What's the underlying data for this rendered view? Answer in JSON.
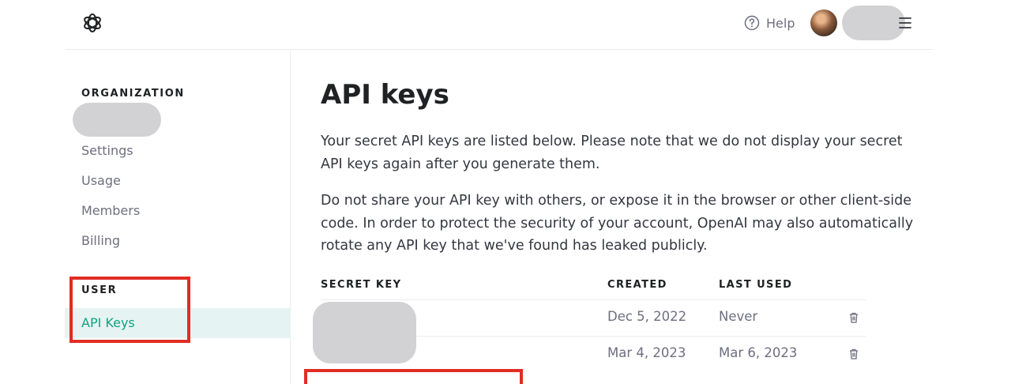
{
  "header": {
    "logo_icon": "openai-logo-icon",
    "help_icon": "question-circle-icon",
    "help_label": "Help",
    "avatar_icon": "user-avatar",
    "menu_icon": "hamburger-menu-icon"
  },
  "sidebar": {
    "organization_title": "ORGANIZATION",
    "org_items": [
      {
        "label": "Settings"
      },
      {
        "label": "Usage"
      },
      {
        "label": "Members"
      },
      {
        "label": "Billing"
      }
    ],
    "user_title": "USER",
    "user_items": [
      {
        "label": "API Keys",
        "active": true
      }
    ]
  },
  "main": {
    "title": "API keys",
    "paragraph_1": "Your secret API keys are listed below. Please note that we do not display your secret API keys again after you generate them.",
    "paragraph_2": "Do not share your API key with others, or expose it in the browser or other client-side code. In order to protect the security of your account, OpenAI may also automatically rotate any API key that we've found has leaked publicly.",
    "table": {
      "columns": [
        "SECRET KEY",
        "CREATED",
        "LAST USED"
      ],
      "rows": [
        {
          "created": "Dec 5, 2022",
          "last_used": "Never",
          "action_icon": "trash-icon"
        },
        {
          "created": "Mar 4, 2023",
          "last_used": "Mar 6, 2023",
          "action_icon": "trash-icon"
        }
      ]
    }
  },
  "colors": {
    "accent": "#10a37f",
    "active_bg": "#e6f3f3",
    "annotation_red": "#e02d24",
    "muted_text": "#6e6e80",
    "redaction_gray": "#d2d2d4"
  }
}
